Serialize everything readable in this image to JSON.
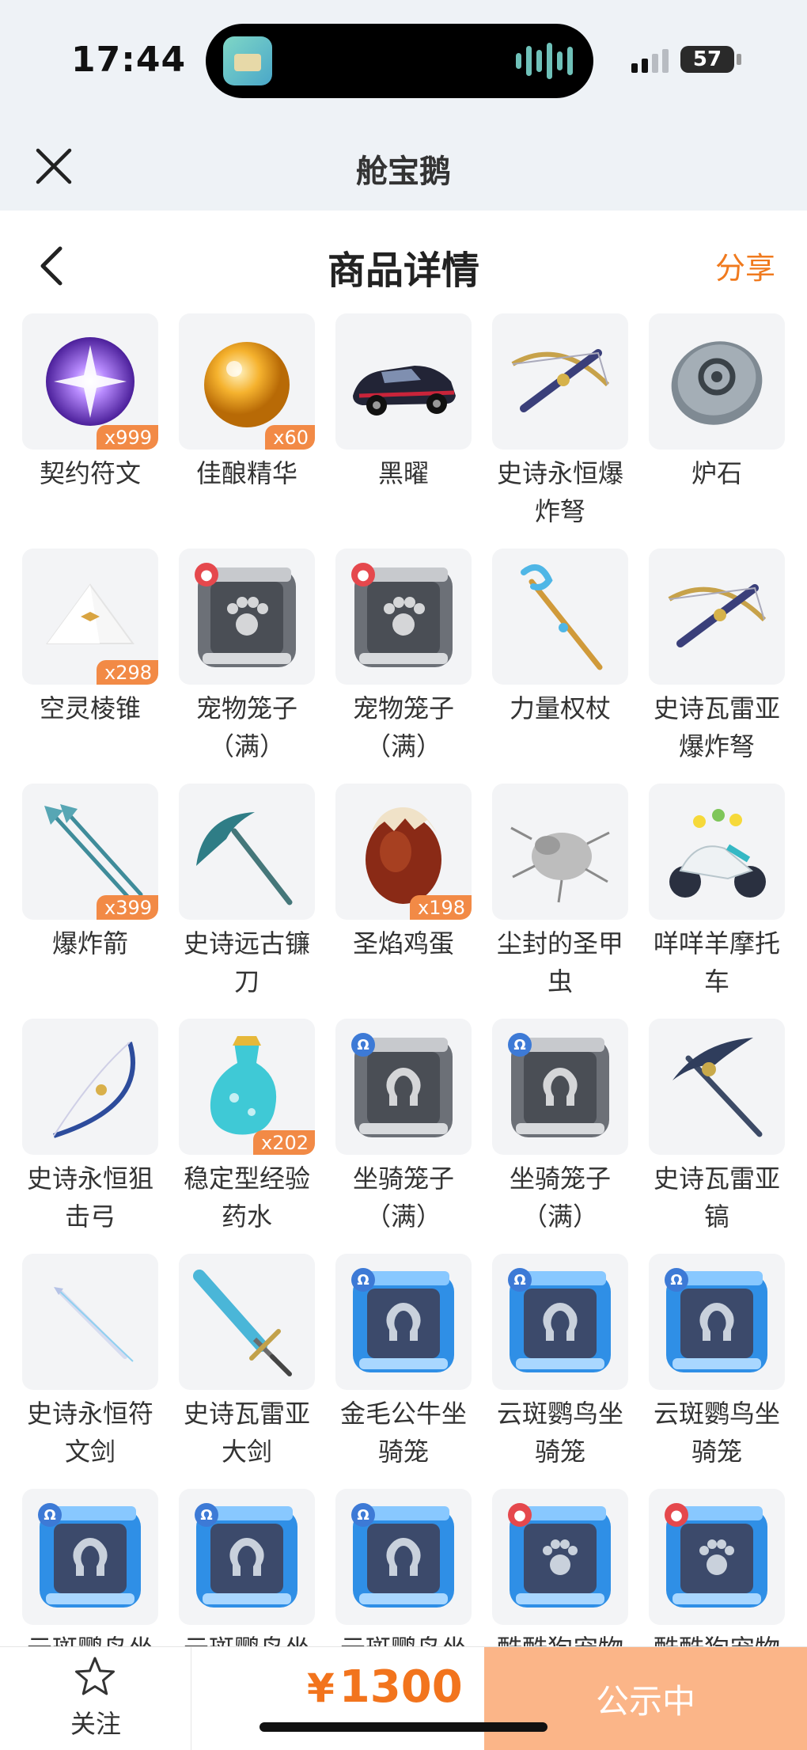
{
  "status_bar": {
    "time": "17:44",
    "battery": "57"
  },
  "app_header": {
    "title": "舱宝鹅"
  },
  "page_header": {
    "title": "商品详情",
    "share_label": "分享"
  },
  "items": [
    {
      "name": "契约符文",
      "count": "x999",
      "icon": "rune-icon"
    },
    {
      "name": "佳酿精华",
      "count": "x60",
      "icon": "essence-orb-icon"
    },
    {
      "name": "黑曜",
      "count": "",
      "icon": "car-icon"
    },
    {
      "name": "史诗永恒爆炸弩",
      "count": "",
      "icon": "crossbow-icon"
    },
    {
      "name": "炉石",
      "count": "",
      "icon": "hearthstone-icon"
    },
    {
      "name": "空灵棱锥",
      "count": "x298",
      "icon": "pyramid-icon"
    },
    {
      "name": "宠物笼子（满）",
      "count": "",
      "icon": "pet-cage-icon",
      "badge": "pet"
    },
    {
      "name": "宠物笼子（满）",
      "count": "",
      "icon": "pet-cage-icon",
      "badge": "pet"
    },
    {
      "name": "力量权杖",
      "count": "",
      "icon": "scepter-icon"
    },
    {
      "name": "史诗瓦雷亚爆炸弩",
      "count": "",
      "icon": "crossbow-icon"
    },
    {
      "name": "爆炸箭",
      "count": "x399",
      "icon": "arrow-icon"
    },
    {
      "name": "史诗远古镰刀",
      "count": "",
      "icon": "scythe-icon"
    },
    {
      "name": "圣焰鸡蛋",
      "count": "x198",
      "icon": "egg-icon"
    },
    {
      "name": "尘封的圣甲虫",
      "count": "",
      "icon": "scarab-icon"
    },
    {
      "name": "咩咩羊摩托车",
      "count": "",
      "icon": "motorcycle-icon"
    },
    {
      "name": "史诗永恒狙击弓",
      "count": "",
      "icon": "bow-icon"
    },
    {
      "name": "稳定型经验药水",
      "count": "x202",
      "icon": "potion-icon"
    },
    {
      "name": "坐骑笼子（满）",
      "count": "",
      "icon": "mount-cage-gray-icon",
      "badge": "mount"
    },
    {
      "name": "坐骑笼子（满）",
      "count": "",
      "icon": "mount-cage-gray-icon",
      "badge": "mount"
    },
    {
      "name": "史诗瓦雷亚镐",
      "count": "",
      "icon": "pickaxe-icon"
    },
    {
      "name": "史诗永恒符文剑",
      "count": "",
      "icon": "rune-sword-icon"
    },
    {
      "name": "史诗瓦雷亚大剑",
      "count": "",
      "icon": "greatsword-icon"
    },
    {
      "name": "金毛公牛坐骑笼",
      "count": "",
      "icon": "mount-cage-blue-icon",
      "badge": "mount"
    },
    {
      "name": "云斑鹦鸟坐骑笼",
      "count": "",
      "icon": "mount-cage-blue-icon",
      "badge": "mount"
    },
    {
      "name": "云斑鹦鸟坐骑笼",
      "count": "",
      "icon": "mount-cage-blue-icon",
      "badge": "mount"
    },
    {
      "name": "云斑鹦鸟坐",
      "count": "",
      "icon": "mount-cage-blue-icon",
      "badge": "mount"
    },
    {
      "name": "云斑鹦鸟坐",
      "count": "",
      "icon": "mount-cage-blue-icon",
      "badge": "mount"
    },
    {
      "name": "云斑鹦鸟坐",
      "count": "",
      "icon": "mount-cage-blue-icon",
      "badge": "mount"
    },
    {
      "name": "酷酷狗宠物",
      "count": "",
      "icon": "pet-cage-blue-icon",
      "badge": "pet"
    },
    {
      "name": "酷酷狗宠物",
      "count": "",
      "icon": "pet-cage-blue-icon",
      "badge": "pet"
    }
  ],
  "bottom_bar": {
    "follow_label": "关注",
    "currency": "¥",
    "price": "1300",
    "status_label": "公示中"
  },
  "colors": {
    "accent": "#f07a1e",
    "status_button": "#fbb588",
    "count_badge": "#f28a46"
  }
}
